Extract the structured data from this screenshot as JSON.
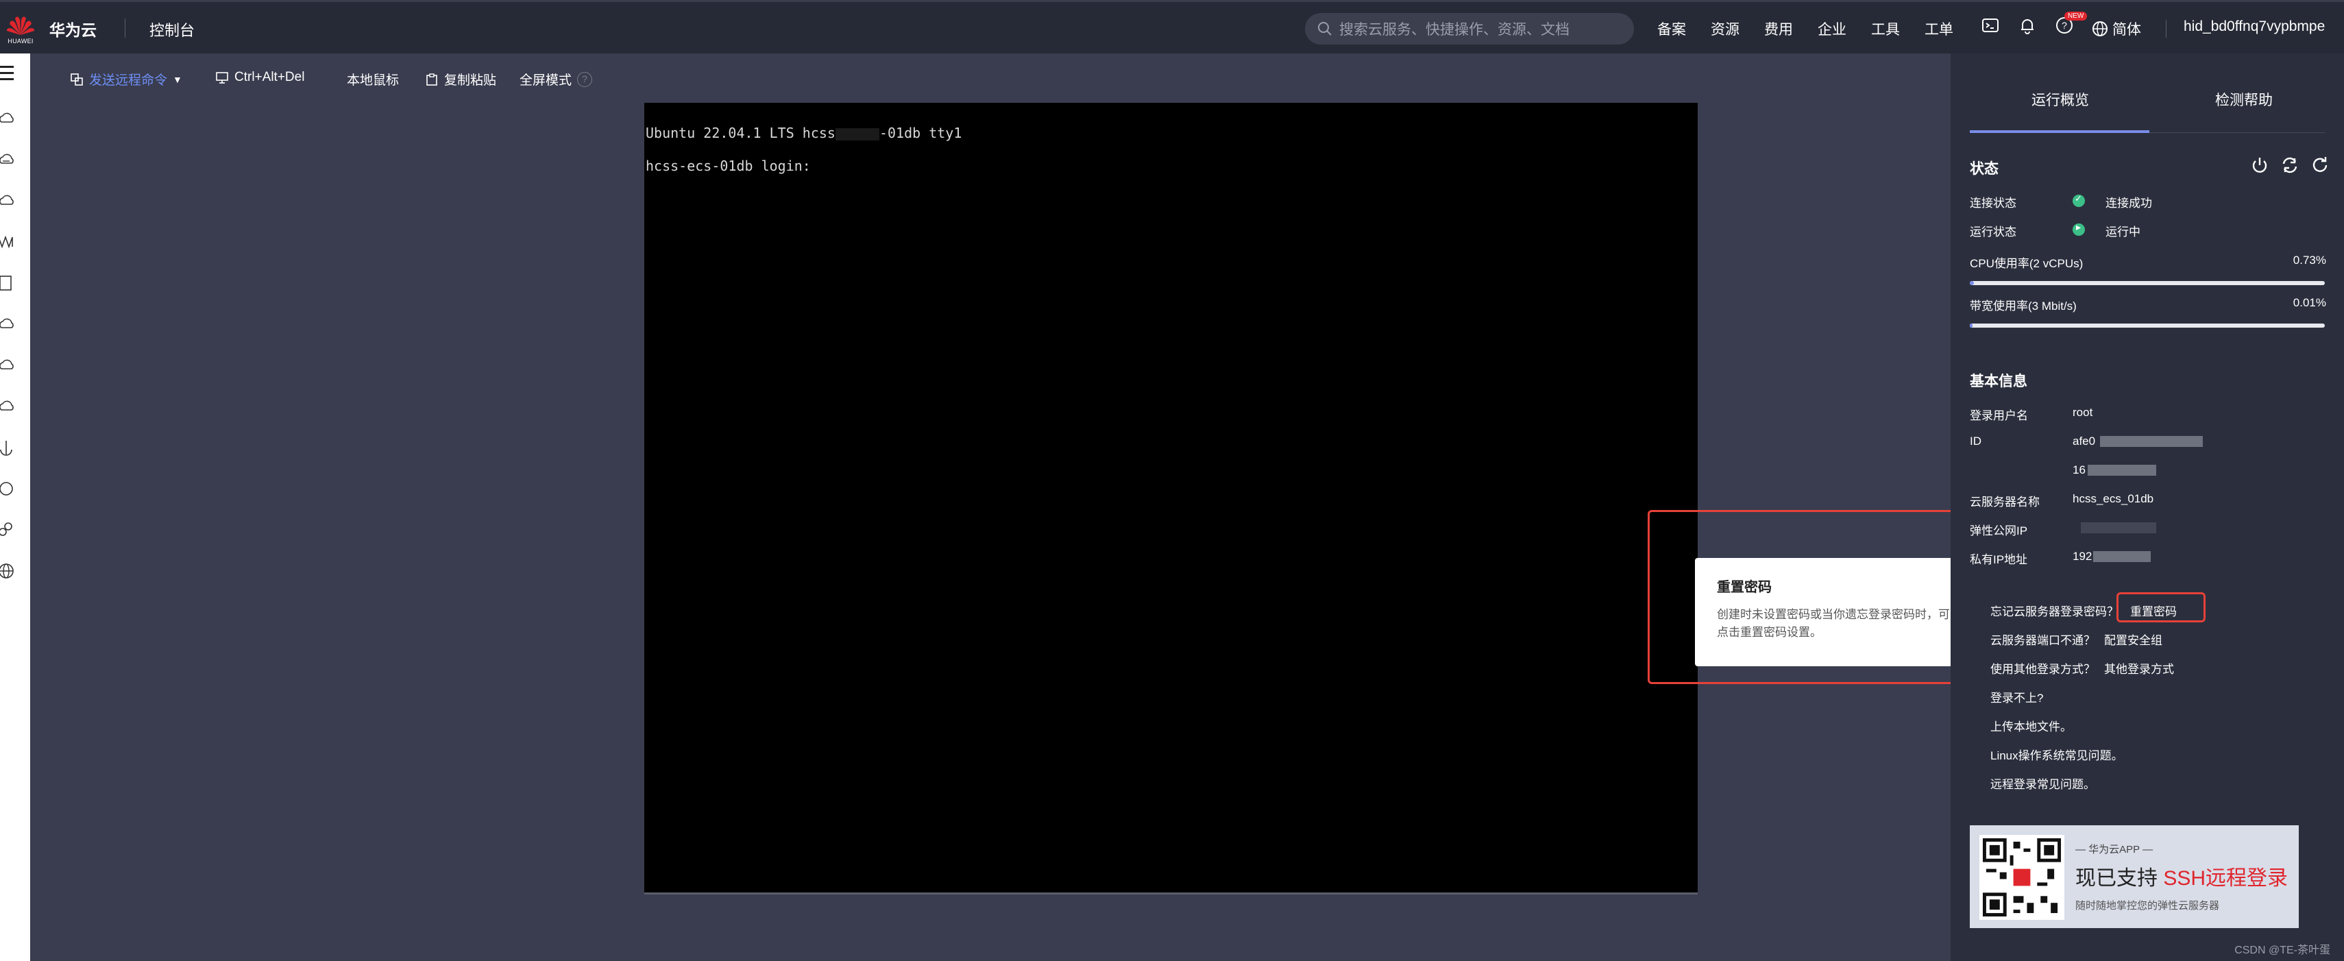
{
  "topbar": {
    "logo_text": "HUAWEI",
    "brand": "华为云",
    "console": "控制台",
    "search_placeholder": "搜索云服务、快捷操作、资源、文档",
    "nav": [
      "备案",
      "资源",
      "费用",
      "企业",
      "工具",
      "工单"
    ],
    "new_badge": "NEW",
    "language": "简体",
    "username": "hid_bd0ffnq7vypbmpe"
  },
  "toolbar": {
    "send_command": "发送远程命令",
    "ctrl_alt_del": "Ctrl+Alt+Del",
    "local_mouse": "本地鼠标",
    "copy_paste": "复制粘贴",
    "fullscreen": "全屏模式",
    "help": "?"
  },
  "terminal": {
    "line1_prefix": "Ubuntu 22.04.1 LTS hcss",
    "line1_suffix": "-01db tty1",
    "line2": "hcss-ecs-01db login:"
  },
  "popover": {
    "title": "重置密码",
    "close": "×",
    "body": "创建时未设置密码或当你遗忘登录密码时，可以点击重置密码设置。"
  },
  "panel": {
    "tabs": [
      "运行概览",
      "检测帮助"
    ],
    "status": {
      "title": "状态",
      "connection_label": "连接状态",
      "connection_value": "连接成功",
      "run_label": "运行状态",
      "run_value": "运行中",
      "cpu_label": "CPU使用率(2 vCPUs)",
      "cpu_pct": "0.73%",
      "cpu_fraction": 0.0073,
      "bw_label": "带宽使用率(3 Mbit/s)",
      "bw_pct": "0.01%",
      "bw_fraction": 0.0001
    },
    "basic": {
      "title": "基本信息",
      "user_label": "登录用户名",
      "user_value": "root",
      "id_label": "ID",
      "id_value1": "afe0",
      "id_value2": "16",
      "name_label": "云服务器名称",
      "name_value": "hcss_ecs_01db",
      "eip_label": "弹性公网IP",
      "private_ip_label": "私有IP地址",
      "private_ip_value": "192"
    },
    "help": {
      "forgot_q": "忘记云服务器登录密码？",
      "forgot_link": "重置密码",
      "port_q": "云服务器端口不通？",
      "port_link": "配置安全组",
      "other_q": "使用其他登录方式？",
      "other_link": "其他登录方式",
      "links": [
        "登录不上?",
        "上传本地文件。",
        "Linux操作系统常见问题。",
        "远程登录常见问题。"
      ]
    },
    "ad": {
      "sub": "— 华为云APP —",
      "big_prefix": "现已支持",
      "big_highlight": "SSH远程登录",
      "small": "随时随地掌控您的弹性云服务器"
    },
    "credit": "CSDN @TE-茶叶蛋"
  }
}
